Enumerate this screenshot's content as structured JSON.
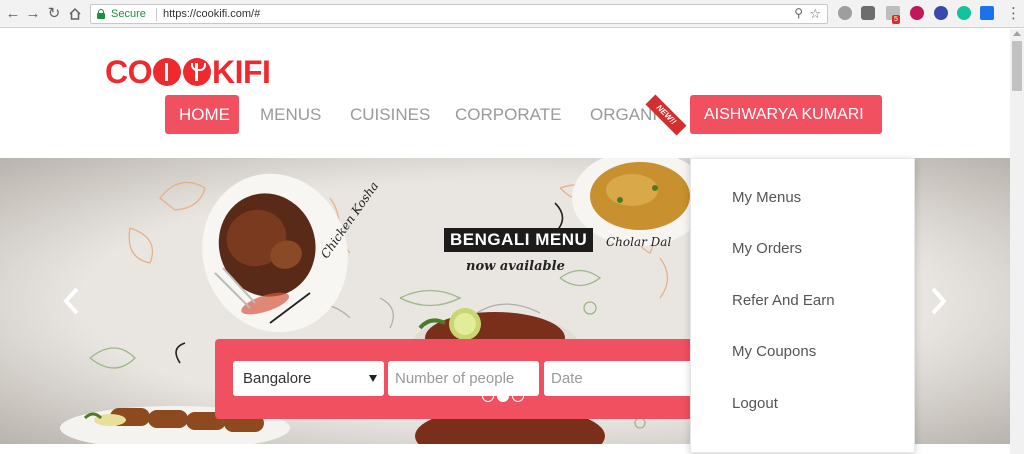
{
  "browser": {
    "secure_label": "Secure",
    "url": "https://cookifi.com/#",
    "ext_badge": "5",
    "icons": [
      "back-icon",
      "forward-icon",
      "reload-icon",
      "home-icon",
      "lock-icon",
      "zoom-icon",
      "star-icon",
      "menu-icon"
    ]
  },
  "brand": {
    "logo_text_left": "CO",
    "logo_text_right": "KIFI",
    "color": "#ee2a2f"
  },
  "nav": {
    "items": [
      {
        "label": "HOME",
        "active": true
      },
      {
        "label": "MENUS"
      },
      {
        "label": "CUISINES"
      },
      {
        "label": "CORPORATE"
      },
      {
        "label": "ORGANIC"
      }
    ],
    "new_badge": "NEW!!",
    "user_label": "AISHWARYA KUMARI",
    "accent": "#f05060"
  },
  "hero": {
    "banner_title": "BENGALI MENU",
    "banner_sub": "now available",
    "dishes": [
      "Chicken Kosha",
      "Cholar Dal"
    ],
    "search": {
      "city": "Bangalore",
      "people_placeholder": "Number of people",
      "date_placeholder": "Date"
    },
    "slides": {
      "count": 3,
      "active": 2
    }
  },
  "user_menu": {
    "items": [
      "My Menus",
      "My Orders",
      "Refer And Earn",
      "My Coupons",
      "Logout"
    ]
  }
}
